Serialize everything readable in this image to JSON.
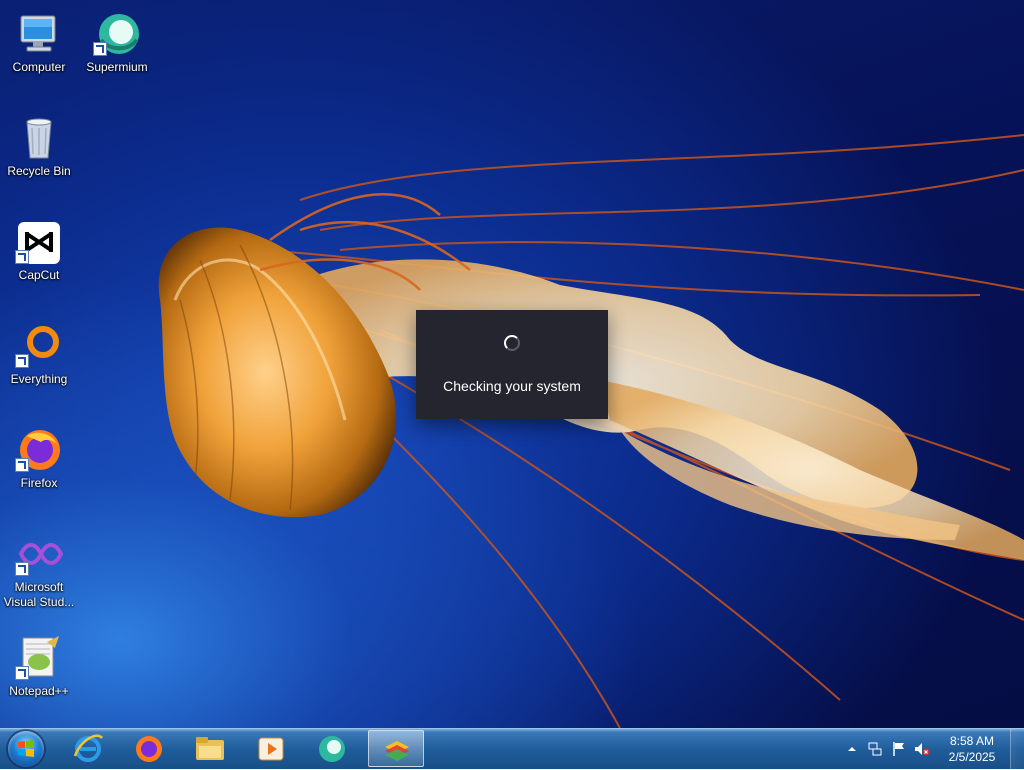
{
  "desktop_icons": [
    {
      "label": "Computer",
      "icon": "computer-icon",
      "shortcut": false
    },
    {
      "label": "Recycle Bin",
      "icon": "recycle-bin-icon",
      "shortcut": false
    },
    {
      "label": "CapCut",
      "icon": "capcut-icon",
      "shortcut": true
    },
    {
      "label": "Everything",
      "icon": "everything-icon",
      "shortcut": true
    },
    {
      "label": "Firefox",
      "icon": "firefox-icon",
      "shortcut": true
    },
    {
      "label": "Microsoft Visual Stud...",
      "icon": "visual-studio-icon",
      "shortcut": true
    },
    {
      "label": "Notepad++",
      "icon": "notepadpp-icon",
      "shortcut": true
    },
    {
      "label": "Supermium",
      "icon": "supermium-icon",
      "shortcut": true
    }
  ],
  "dialog": {
    "message": "Checking your system",
    "status_icon": "loading-spinner-icon"
  },
  "taskbar": {
    "start_icon": "windows-start-icon",
    "pinned": [
      {
        "icon": "internet-explorer-icon",
        "active": false
      },
      {
        "icon": "firefox-icon",
        "active": false
      },
      {
        "icon": "file-explorer-icon",
        "active": false
      },
      {
        "icon": "media-player-icon",
        "active": false
      },
      {
        "icon": "supermium-icon",
        "active": false
      },
      {
        "icon": "bluestacks-icon",
        "active": true
      }
    ],
    "tray": {
      "icons": [
        "show-hidden-icons-icon",
        "network-icon",
        "action-center-flag-icon",
        "volume-muted-icon"
      ],
      "time": "8:58 AM",
      "date": "2/5/2025"
    }
  },
  "colors": {
    "dialog_bg": "#24252f",
    "taskbar": "#1f5d9b",
    "wallpaper_deep": "#061257"
  }
}
